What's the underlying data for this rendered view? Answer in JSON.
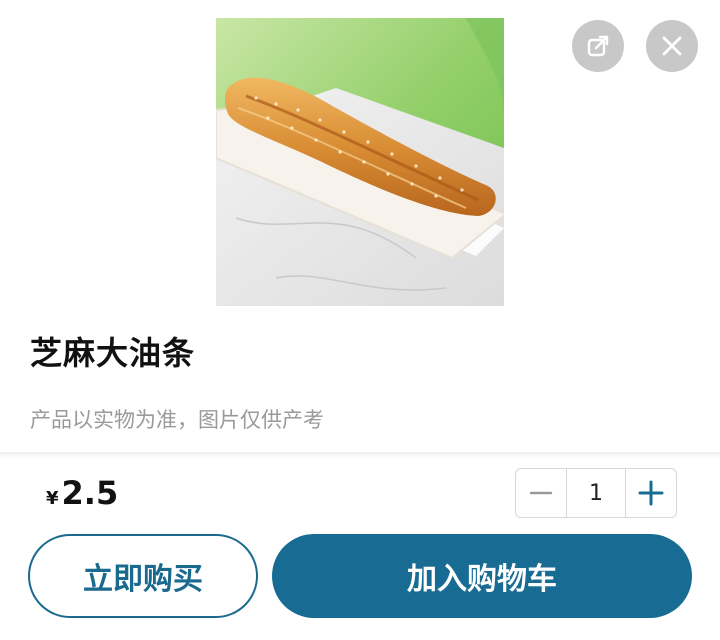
{
  "product": {
    "name": "芝麻大油条",
    "note": "产品以实物为准，图片仅供产考",
    "image_alt": "sesame-fried-dough-stick"
  },
  "price": {
    "symbol": "¥",
    "value": "2.5"
  },
  "quantity": {
    "value": "1"
  },
  "actions": {
    "buy_now": "立即购买",
    "add_to_cart": "加入购物车"
  },
  "icons": {
    "share": "share-icon",
    "close": "close-icon",
    "minus": "minus-icon",
    "plus": "plus-icon"
  },
  "colors": {
    "primary": "#186b92",
    "icon_bg": "#c8c8c8",
    "muted_text": "#9a9a9a"
  }
}
